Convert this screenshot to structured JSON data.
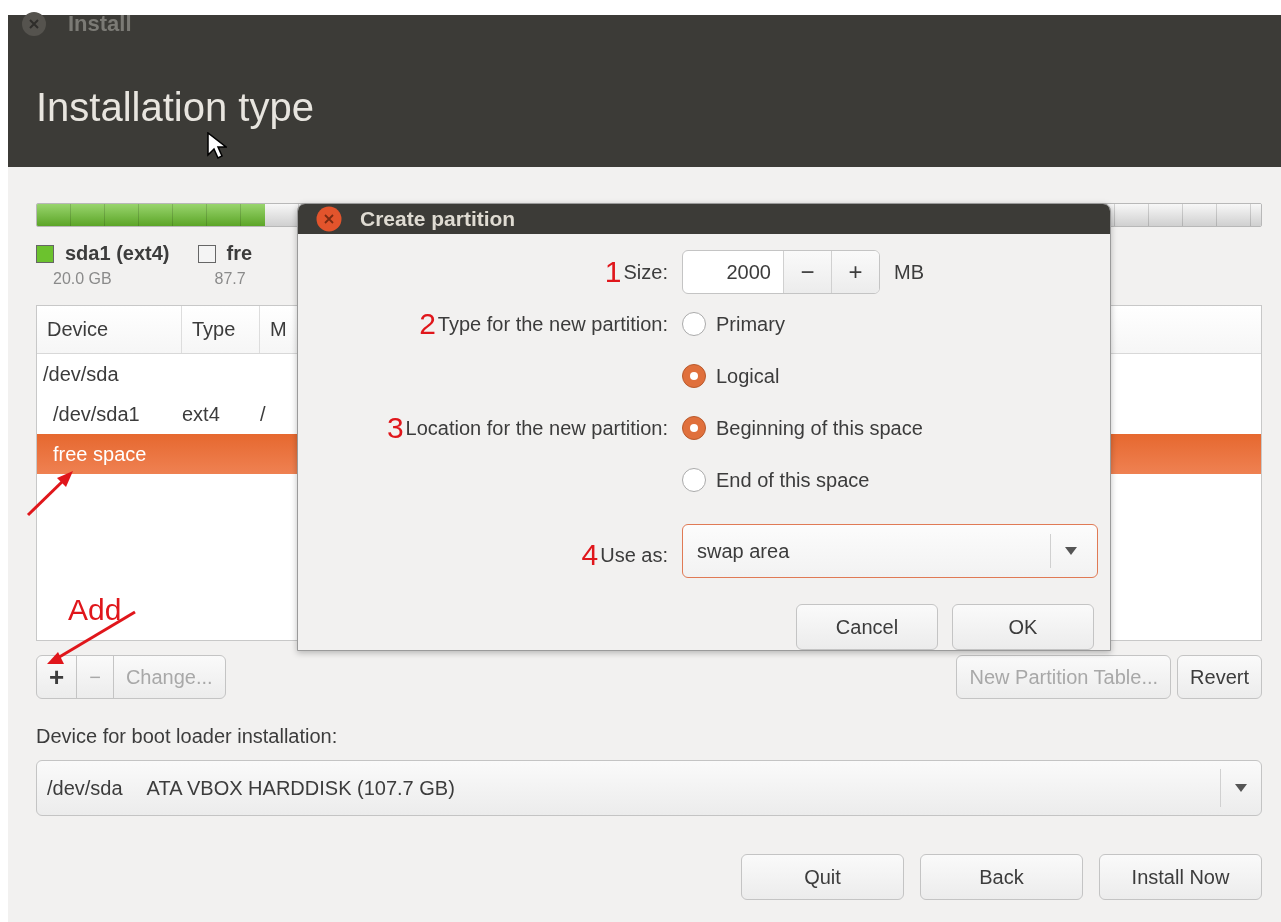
{
  "window": {
    "title": "Install",
    "heading": "Installation type"
  },
  "disk": {
    "partitions": [
      {
        "name": "sda1 (ext4)",
        "size": "20.0 GB",
        "color": "#6cc22e",
        "level": 0.186
      },
      {
        "name": "fre",
        "size": "87.7",
        "color": "#f4f4f4",
        "level": 0.814
      }
    ]
  },
  "table": {
    "columns": [
      "Device",
      "Type",
      "M"
    ],
    "rows": [
      {
        "device": "/dev/sda",
        "selected": false,
        "children": [
          {
            "device": "/dev/sda1",
            "type": "ext4",
            "mount": "/",
            "selected": false
          },
          {
            "device": "free space",
            "selected": true
          }
        ]
      }
    ]
  },
  "toolbar": {
    "left": [
      {
        "label": "+",
        "disabled": false
      },
      {
        "label": "−",
        "disabled": true
      },
      {
        "label": "Change...",
        "disabled": true
      }
    ],
    "right": [
      {
        "label": "New Partition Table...",
        "disabled": true
      },
      {
        "label": "Revert",
        "disabled": false
      }
    ]
  },
  "boot_loader": {
    "label": "Device for boot loader installation:",
    "device": "/dev/sda",
    "description": "ATA VBOX HARDDISK (107.7 GB)"
  },
  "buttons": [
    "Quit",
    "Back",
    "Install Now"
  ],
  "dialog": {
    "title": "Create partition",
    "size": {
      "annotation": "1",
      "label": "Size:",
      "value": "2000",
      "minus": "−",
      "plus": "+",
      "unit": "MB"
    },
    "type": {
      "annotation": "2",
      "label": "Type for the new partition:",
      "options": [
        {
          "label": "Primary",
          "selected": false
        },
        {
          "label": "Logical",
          "selected": true
        }
      ]
    },
    "location": {
      "annotation": "3",
      "label": "Location for the new partition:",
      "options": [
        {
          "label": "Beginning of this space",
          "selected": true
        },
        {
          "label": "End of this space",
          "selected": false
        }
      ]
    },
    "use_as": {
      "annotation": "4",
      "label": "Use as:",
      "value": "swap area"
    },
    "buttons": [
      "Cancel",
      "OK"
    ]
  },
  "add_annotation": "Add"
}
